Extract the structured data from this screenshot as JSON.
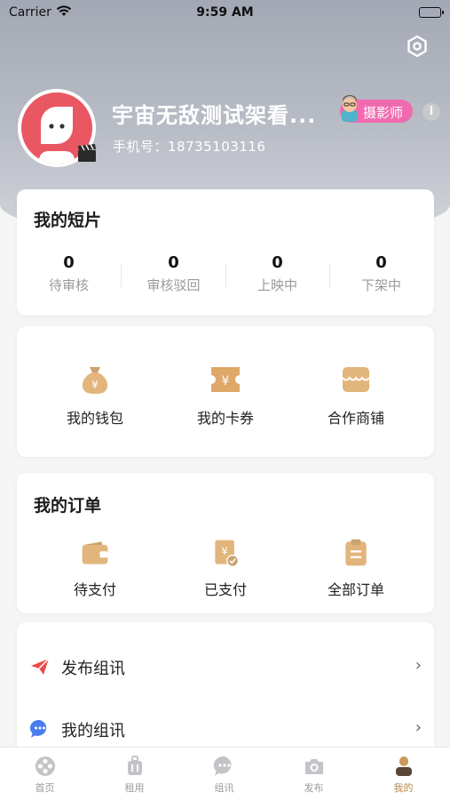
{
  "status_bar": {
    "carrier": "Carrier",
    "time": "9:59 AM"
  },
  "profile": {
    "username": "宇宙无敌测试架看...",
    "role": "摄影师",
    "phone": "手机号：18735103116"
  },
  "shorts": {
    "title": "我的短片",
    "stats": [
      {
        "value": "0",
        "label": "待审核"
      },
      {
        "value": "0",
        "label": "审核驳回"
      },
      {
        "value": "0",
        "label": "上映中"
      },
      {
        "value": "0",
        "label": "下架中"
      }
    ]
  },
  "wallet_section": {
    "items": [
      {
        "label": "我的钱包",
        "icon": "money-bag-icon"
      },
      {
        "label": "我的卡券",
        "icon": "coupon-icon"
      },
      {
        "label": "合作商铺",
        "icon": "shop-icon"
      }
    ]
  },
  "orders": {
    "title": "我的订单",
    "items": [
      {
        "label": "待支付",
        "icon": "wallet-icon"
      },
      {
        "label": "已支付",
        "icon": "paid-receipt-icon"
      },
      {
        "label": "全部订单",
        "icon": "clipboard-icon"
      }
    ]
  },
  "menu": {
    "items": [
      {
        "label": "发布组讯",
        "icon": "paper-plane-icon"
      },
      {
        "label": "我的组讯",
        "icon": "chat-bubble-icon"
      }
    ]
  },
  "tabbar": {
    "tabs": [
      {
        "label": "首页",
        "icon": "film-reel-icon"
      },
      {
        "label": "租用",
        "icon": "suitcase-icon"
      },
      {
        "label": "组讯",
        "icon": "chat-icon"
      },
      {
        "label": "发布",
        "icon": "camera-icon"
      },
      {
        "label": "我的",
        "icon": "person-icon"
      }
    ],
    "active_index": 4
  },
  "colors": {
    "accent": "#b5874a",
    "gold": "#d9a86a",
    "avatar_bg": "#e95763",
    "badge_pink": "#f06ab0",
    "send_red": "#ef4a4a",
    "chat_blue": "#4a7cf0"
  }
}
